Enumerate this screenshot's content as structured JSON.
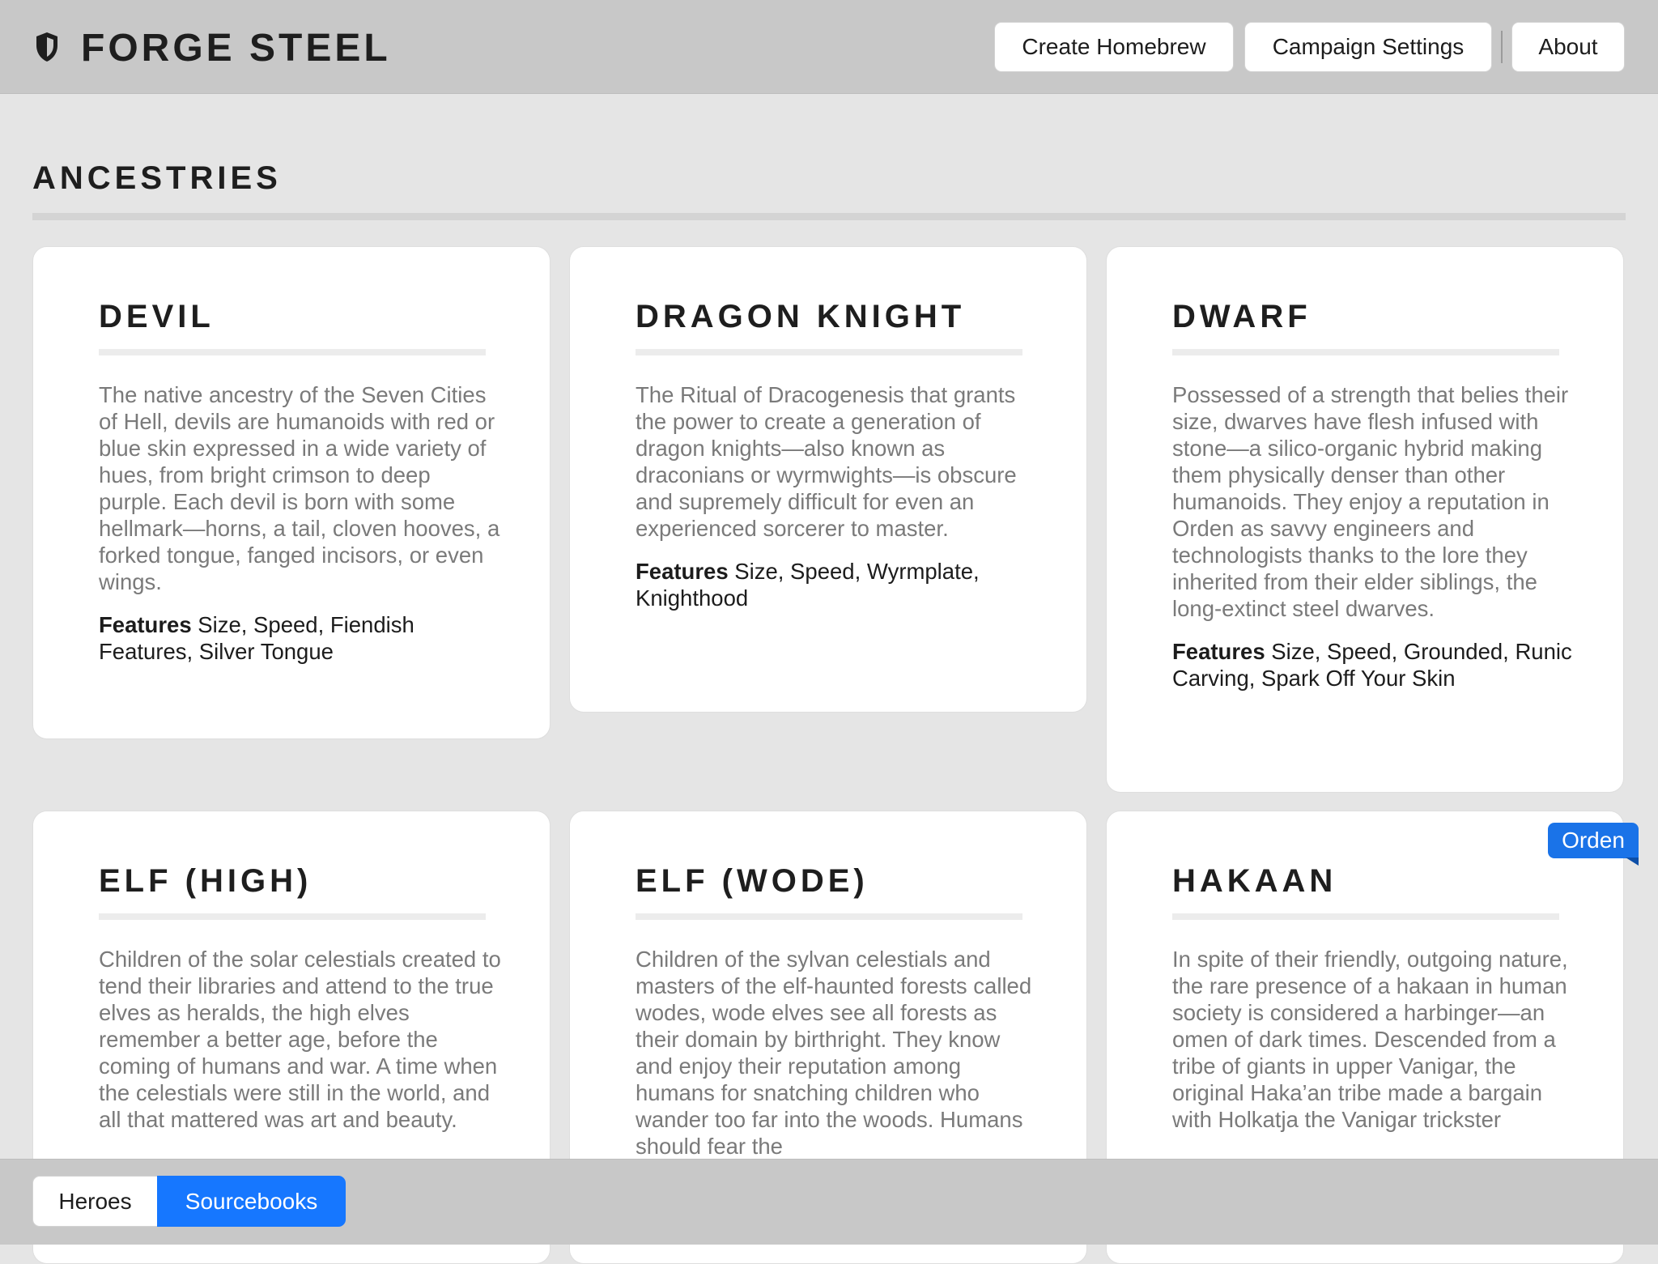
{
  "app": {
    "title": "FORGE STEEL"
  },
  "header": {
    "buttons": {
      "create_homebrew": "Create Homebrew",
      "campaign_settings": "Campaign Settings",
      "about": "About"
    }
  },
  "section": {
    "title": "ANCESTRIES"
  },
  "features_label": "Features",
  "cards": [
    {
      "title": "DEVIL",
      "description": "The native ancestry of the Seven Cities of Hell, devils are humanoids with red or blue skin expressed in a wide variety of hues, from bright crimson to deep purple. Each devil is born with some hellmark—horns, a tail, cloven hooves, a forked tongue, fanged incisors, or even wings.",
      "features": "Size, Speed, Fiendish Features, Silver Tongue"
    },
    {
      "title": "DRAGON KNIGHT",
      "description": "The Ritual of Dracogenesis that grants the power to create a generation of dragon knights—also known as draconians or wyrmwights—is obscure and supremely difficult for even an experienced sorcerer to master.",
      "features": "Size, Speed, Wyrmplate, Knighthood"
    },
    {
      "title": "DWARF",
      "description": "Possessed of a strength that belies their size, dwarves have flesh infused with stone—a silico-organic hybrid making them physically denser than other humanoids. They enjoy a reputation in Orden as savvy engineers and technologists thanks to the lore they inherited from their elder siblings, the long-extinct steel dwarves.",
      "features": "Size, Speed, Grounded, Runic Carving, Spark Off Your Skin"
    },
    {
      "title": "ELF (HIGH)",
      "description": "Children of the solar celestials created to tend their libraries and attend to the true elves as heralds, the high elves remember a better age, before the coming of humans and war. A time when the celestials were still in the world, and all that mattered was art and beauty."
    },
    {
      "title": "ELF (WODE)",
      "description": "Children of the sylvan celestials and masters of the elf-haunted forests called wodes, wode elves see all forests as their domain by birthright. They know and enjoy their reputation among humans for snatching children who wander too far into the woods. Humans should fear the"
    },
    {
      "title": "HAKAAN",
      "description": "In spite of their friendly, outgoing nature, the rare presence of a hakaan in human society is considered a harbinger—an omen of dark times. Descended from a tribe of giants in upper Vanigar, the original Haka’an tribe made a bargain with Holkatja the Vanigar trickster",
      "tag": "Orden"
    }
  ],
  "footer": {
    "tabs": {
      "heroes": "Heroes",
      "sourcebooks": "Sourcebooks"
    },
    "active_tab": "Sourcebooks"
  },
  "colors": {
    "accent": "#1677ff",
    "header_bg": "#c8c8c8",
    "page_bg": "#e5e5e5",
    "tag_bg": "#1a73e8"
  }
}
